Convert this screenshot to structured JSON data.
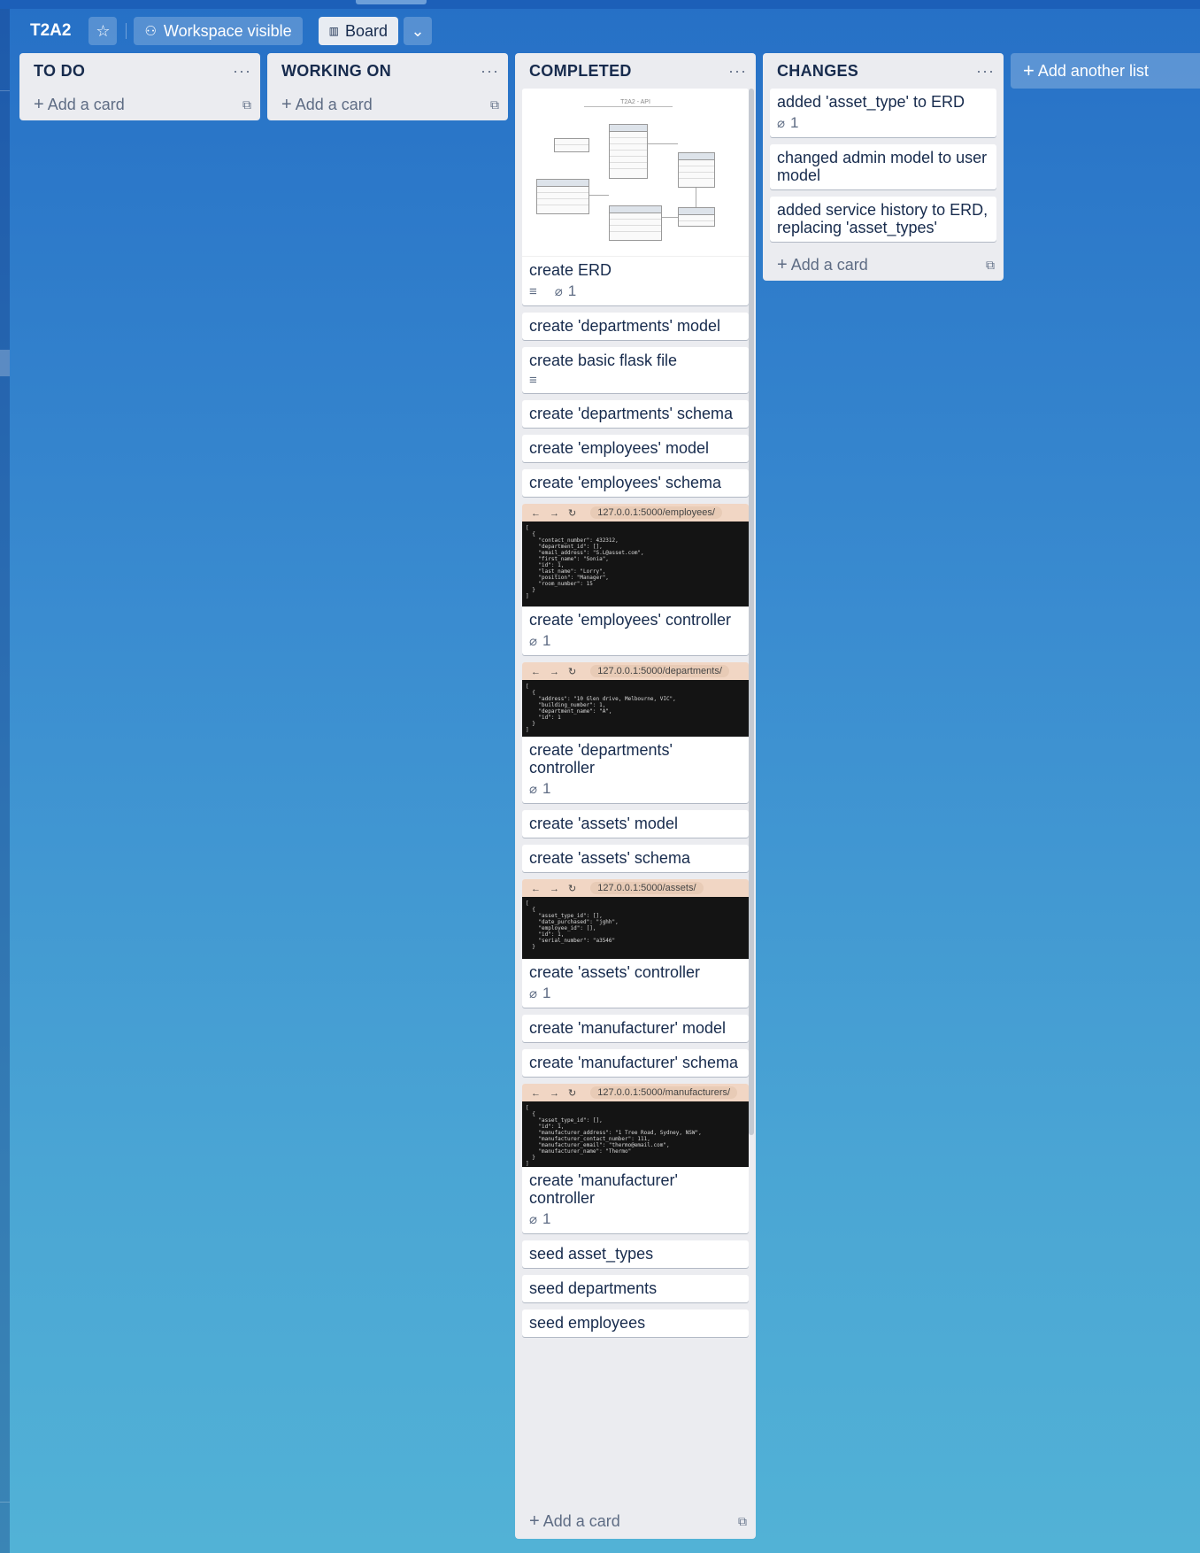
{
  "board": {
    "title": "T2A2",
    "visibility_label": "Workspace visible",
    "view_label": "Board"
  },
  "icons": {
    "star": "star-icon",
    "visibility": "people-icon",
    "board": "board-view-icon",
    "chevron": "chevron-down-icon",
    "menu": "ellipsis-icon",
    "add": "plus-icon",
    "template": "card-template-icon",
    "description": "description-icon",
    "attachment": "paperclip-icon"
  },
  "lists": [
    {
      "title": "TO DO",
      "add_card": "Add a card",
      "cards": []
    },
    {
      "title": "WORKING ON",
      "add_card": "Add a card",
      "cards": []
    },
    {
      "title": "COMPLETED",
      "add_card": "Add a card",
      "cards": [
        {
          "title": "create ERD",
          "cover": "erd-diagram",
          "description": true,
          "attachments": "1"
        },
        {
          "title": "create 'departments' model"
        },
        {
          "title": "create basic flask file",
          "description": true
        },
        {
          "title": "create 'departments' schema"
        },
        {
          "title": "create 'employees' model"
        },
        {
          "title": "create 'employees' schema"
        },
        {
          "title": "create 'employees' controller",
          "cover": "screenshot",
          "cover_url": "127.0.0.1:5000/employees/",
          "attachments": "1"
        },
        {
          "title": "create 'departments' controller",
          "cover": "screenshot",
          "cover_url": "127.0.0.1:5000/departments/",
          "attachments": "1"
        },
        {
          "title": "create 'assets' model"
        },
        {
          "title": "create 'assets' schema"
        },
        {
          "title": "create 'assets' controller",
          "cover": "screenshot",
          "cover_url": "127.0.0.1:5000/assets/",
          "attachments": "1"
        },
        {
          "title": "create 'manufacturer' model"
        },
        {
          "title": "create 'manufacturer' schema"
        },
        {
          "title": "create 'manufacturer' controller",
          "cover": "screenshot",
          "cover_url": "127.0.0.1:5000/manufacturers/",
          "attachments": "1"
        },
        {
          "title": "seed asset_types"
        },
        {
          "title": "seed departments"
        },
        {
          "title": "seed employees"
        }
      ]
    },
    {
      "title": "CHANGES",
      "add_card": "Add a card",
      "cards": [
        {
          "title": "added 'asset_type' to ERD",
          "attachments": "1"
        },
        {
          "title": "changed admin model to user model"
        },
        {
          "title": "added service history to ERD, replacing 'asset_types'"
        }
      ]
    }
  ],
  "add_list_label": "Add another list",
  "cover_text": {
    "erd_title": "T2A2 - API",
    "employees": "[\n  {\n    \"contact_number\": 432312,\n    \"department_id\": [],\n    \"email_address\": \"S.L@asset.com\",\n    \"first_name\": \"Sonia\",\n    \"id\": 1,\n    \"last_name\": \"Lorry\",\n    \"position\": \"Manager\",\n    \"room_number\": 15\n  }\n]",
    "departments": "[\n  {\n    \"address\": \"10 Glen drive, Melbourne, VIC\",\n    \"building_number\": 1,\n    \"department_name\": \"A\",\n    \"id\": 1\n  }\n]",
    "assets": "[\n  {\n    \"asset_type_id\": [],\n    \"date_purchased\": \"jghh\",\n    \"employee_id\": [],\n    \"id\": 1,\n    \"serial_number\": \"a3546\"\n  }",
    "manufacturers": "[\n  {\n    \"asset_type_id\": [],\n    \"id\": 1,\n    \"manufacturer_address\": \"1 Tree Road, Sydney, NSW\",\n    \"manufacturer_contact_number\": 111,\n    \"manufacturer_email\": \"thermo@email.com\",\n    \"manufacturer_name\": \"Thermo\"\n  }\n]"
  },
  "colors": {
    "background_top": "#2670c6",
    "background_bottom": "#52b2d6",
    "list_bg": "#ebecf0",
    "card_bg": "#ffffff",
    "text": "#172b4d",
    "muted": "#5e6c84"
  }
}
